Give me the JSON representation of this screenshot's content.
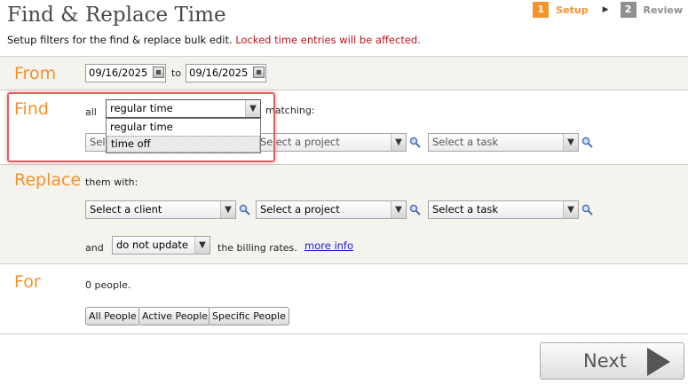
{
  "header": {
    "title": "Find & Replace Time",
    "subtitle": "Setup filters for the find & replace bulk edit.",
    "warning": "Locked time entries will be affected."
  },
  "steps": [
    {
      "number": "1",
      "label": "Setup",
      "active": true
    },
    {
      "number": "2",
      "label": "Review",
      "active": false
    }
  ],
  "colors": {
    "accent": "#f5922a",
    "warning": "#c0141c",
    "link": "#1a1ad0",
    "highlight": "#e2605f"
  },
  "from": {
    "label": "From",
    "start_date": "09/16/2025",
    "to_label": "to",
    "end_date": "09/16/2025"
  },
  "find": {
    "label": "Find",
    "all_label": "all",
    "type_value": "regular time",
    "matching_label": "matching:",
    "client_placeholder": "Select a client",
    "project_placeholder": "Select a project",
    "task_placeholder": "Select a task",
    "dropdown_options": [
      "regular time",
      "time off"
    ]
  },
  "replace": {
    "label": "Replace",
    "them_with": "them with:",
    "client_placeholder": "Select a client",
    "project_placeholder": "Select a project",
    "task_placeholder": "Select a task",
    "and_label": "and",
    "billing_value": "do not update",
    "billing_text": "the billing rates.",
    "more_info": "more info"
  },
  "for": {
    "label": "For",
    "people_count": "0 people.",
    "buttons": [
      "All People",
      "Active People",
      "Specific People"
    ]
  },
  "footer": {
    "next_label": "Next"
  },
  "icons": [
    "calendar-icon",
    "magnifier-icon",
    "chevron-down-icon",
    "next-arrow-icon"
  ]
}
